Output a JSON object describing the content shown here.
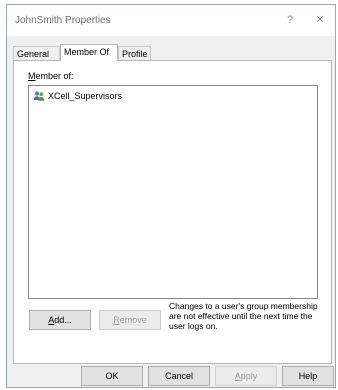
{
  "window": {
    "title": "JohnSmith Properties",
    "help_glyph": "?",
    "close_glyph": "✕"
  },
  "tabs": [
    {
      "label": "General",
      "active": false
    },
    {
      "label": "Member Of",
      "active": true
    },
    {
      "label": "Profile",
      "active": false
    }
  ],
  "member_of": {
    "label_first": "M",
    "label_rest": "ember of:",
    "items": [
      {
        "name": "XCell_Supervisors",
        "icon": "group-icon"
      }
    ]
  },
  "panel_buttons": {
    "add_first": "A",
    "add_rest": "dd...",
    "remove_first": "R",
    "remove_rest": "emove"
  },
  "note": "Changes to a user's group membership are not effective until the next time the user logs on.",
  "footer": {
    "ok": "OK",
    "cancel": "Cancel",
    "apply_first": "A",
    "apply_rest": "pply",
    "help": "Help"
  }
}
